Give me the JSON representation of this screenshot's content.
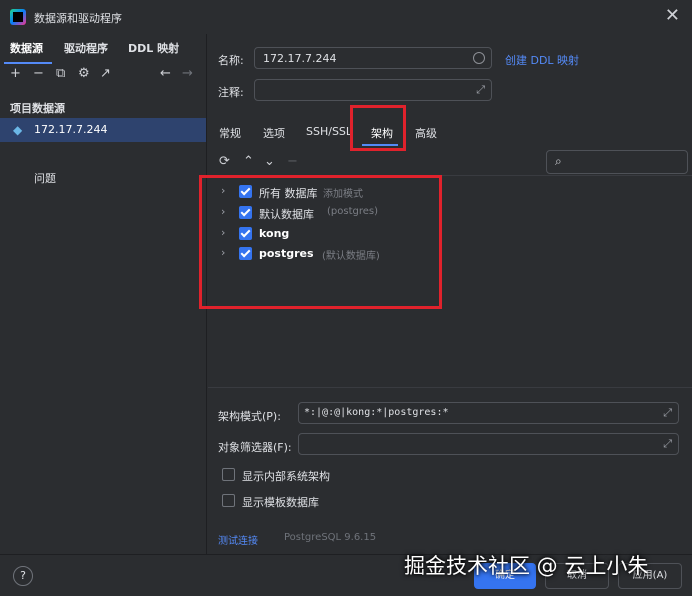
{
  "window": {
    "title": "数据源和驱动程序",
    "close": "✕"
  },
  "sidebar": {
    "tabs": [
      {
        "label": "数据源"
      },
      {
        "label": "驱动程序"
      },
      {
        "label": "DDL 映射"
      }
    ],
    "section_title": "项目数据源",
    "items": [
      {
        "label": "172.17.7.244"
      }
    ],
    "problems": "问题"
  },
  "form": {
    "name_label": "名称:",
    "name_value": "172.17.7.244",
    "create_ddl_link": "创建 DDL 映射",
    "comment_label": "注释:",
    "comment_value": ""
  },
  "tabs": [
    {
      "label": "常规"
    },
    {
      "label": "选项"
    },
    {
      "label": "SSH/SSL"
    },
    {
      "label": "架构"
    },
    {
      "label": "高级"
    }
  ],
  "schema_tree": [
    {
      "label": "所有 数据库",
      "hint": "添加模式",
      "checked": true
    },
    {
      "label": "默认数据库",
      "hint": "(postgres)",
      "checked": true
    },
    {
      "label": "kong",
      "hint": "",
      "checked": true
    },
    {
      "label": "postgres",
      "hint": "(默认数据库)",
      "checked": true
    }
  ],
  "pattern": {
    "label": "架构模式(P):",
    "value": "*:|@:@|kong:*|postgres:*"
  },
  "filter": {
    "label": "对象筛选器(F):",
    "value": ""
  },
  "options": [
    {
      "label": "显示内部系统架构",
      "checked": false
    },
    {
      "label": "显示模板数据库",
      "checked": false
    }
  ],
  "footer": {
    "test_connection": "测试连接",
    "version": "PostgreSQL 9.6.15",
    "help": "?",
    "ok": "确定",
    "cancel": "取消",
    "apply": "应用(A)"
  },
  "watermark": "掘金技术社区 @ 云上小朱",
  "colors": {
    "accent": "#548af7",
    "highlight": "#e0222c",
    "selection": "#2e436e",
    "checkbox": "#3574f0"
  }
}
